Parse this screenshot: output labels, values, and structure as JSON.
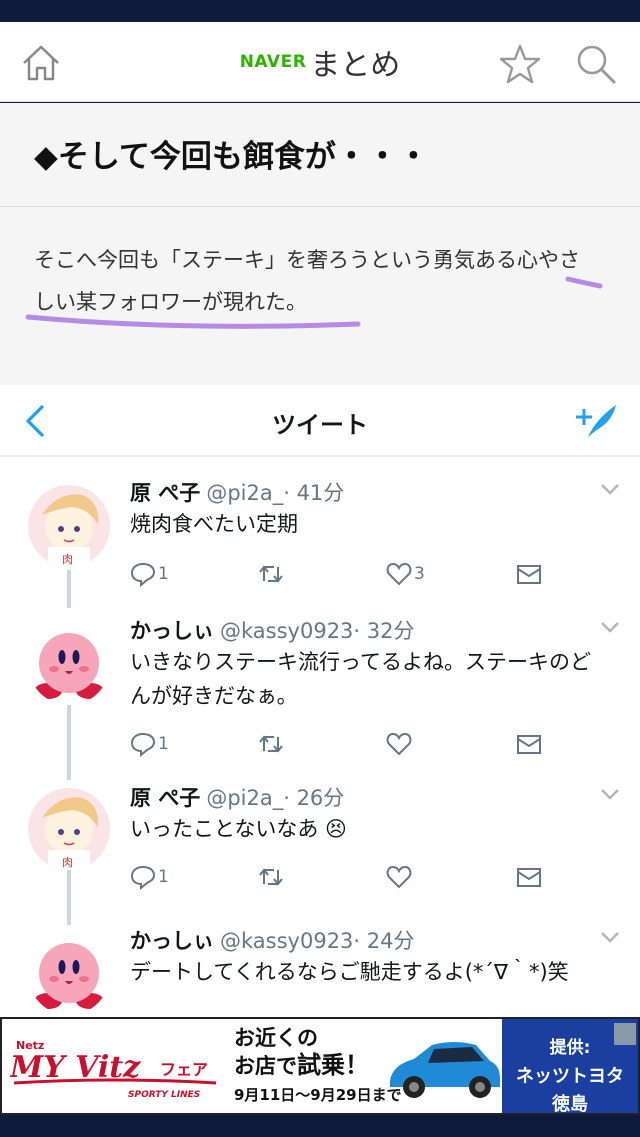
{
  "header": {
    "logo_brand": "NAVER",
    "logo_text": "まとめ"
  },
  "article": {
    "title": "◆そして今回も餌食が・・・",
    "body": "そこへ今回も「ステーキ」を奢ろうという勇気ある心やさしい某フォロワーが現れた。",
    "underline_color": "#b48be6"
  },
  "twitter": {
    "title": "ツイート",
    "tweets": [
      {
        "name": "原 ぺ子",
        "handle": "@pi2a_",
        "time": "· 41分",
        "text": "焼肉食べたい定期",
        "reply_count": "1",
        "like_count": "3"
      },
      {
        "name": "かっしぃ",
        "handle": "@kassy0923",
        "time": "· 32分",
        "text": "いきなりステーキ流行ってるよね。ステーキのどんが好きだなぁ。",
        "reply_count": "1",
        "like_count": ""
      },
      {
        "name": "原 ぺ子",
        "handle": "@pi2a_",
        "time": "· 26分",
        "text": "いったことないなあ 😣",
        "reply_count": "1",
        "like_count": ""
      },
      {
        "name": "かっしぃ",
        "handle": "@kassy0923",
        "time": "· 24分",
        "text": "デートしてくれるならご馳走するよ(*´∇｀*)笑",
        "reply_count": "",
        "like_count": ""
      }
    ]
  },
  "ad": {
    "brand_small": "Netz",
    "brand_name": "MY Vitzフェア",
    "brand_tag": "SPORTY LINES",
    "line1": "お近くの",
    "line2a": "お店で",
    "line2b": "試乗！",
    "line3": "9月11日～9月29日まで",
    "provider_label": "提供:",
    "provider_name1": "ネッツトヨタ",
    "provider_name2": "徳島"
  },
  "colors": {
    "naver_green": "#2db400",
    "status_bar": "#0f1a3d",
    "twitter_blue": "#1da1f2",
    "ad_blue": "#1b3fa0"
  },
  "icons": [
    "home-icon",
    "star-icon",
    "search-icon",
    "back-arrow-icon",
    "compose-icon",
    "reply-icon",
    "retweet-icon",
    "like-icon",
    "dm-icon",
    "chevron-down-icon"
  ]
}
